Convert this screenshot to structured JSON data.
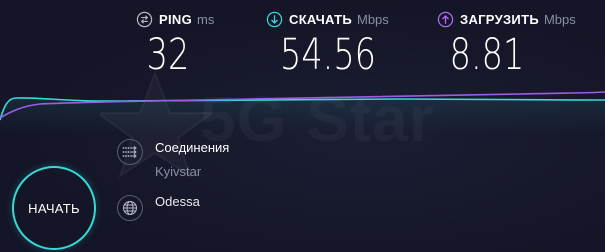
{
  "metrics": {
    "ping": {
      "label": "PING",
      "unit": "ms",
      "value": "32",
      "icon": "ping-icon",
      "color": "#b7b9c9"
    },
    "download": {
      "label": "СКАЧАТЬ",
      "unit": "Mbps",
      "value": "54.56",
      "icon": "download-arrow-icon",
      "color": "#35d9d6"
    },
    "upload": {
      "label": "ЗАГРУЗИТЬ",
      "unit": "Mbps",
      "value": "8.81",
      "icon": "upload-arrow-icon",
      "color": "#b06cf0"
    }
  },
  "start_button": {
    "label": "НАЧАТЬ",
    "color": "#35d9d6"
  },
  "connections": {
    "label": "Соединения",
    "provider": "Kyivstar",
    "icon": "connections-icon"
  },
  "server": {
    "location": "Odessa",
    "icon": "globe-icon"
  },
  "graph": {
    "download_color": "#35d9d6",
    "upload_color": "#9b5de5"
  },
  "watermark": {
    "text": "5G Star",
    "icon": "star-logo"
  }
}
